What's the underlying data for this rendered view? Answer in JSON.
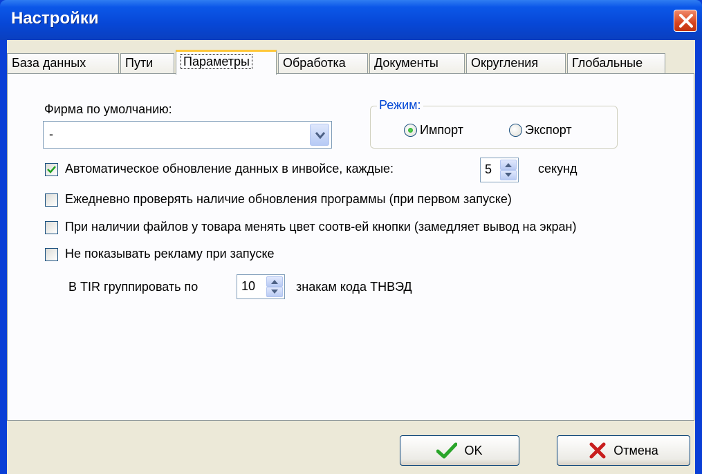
{
  "window": {
    "title": "Настройки"
  },
  "tabs": [
    {
      "label": "База данных"
    },
    {
      "label": "Пути"
    },
    {
      "label": "Параметры"
    },
    {
      "label": "Обработка"
    },
    {
      "label": "Документы"
    },
    {
      "label": "Округления"
    },
    {
      "label": "Глобальные"
    }
  ],
  "active_tab": "Параметры",
  "firm": {
    "label": "Фирма по умолчанию:",
    "value": "-"
  },
  "mode": {
    "legend": "Режим:",
    "options": [
      {
        "label": "Импорт",
        "selected": true
      },
      {
        "label": "Экспорт",
        "selected": false
      }
    ]
  },
  "options": [
    {
      "label": "Автоматическое обновление данных в инвойсе, каждые:",
      "checked": true
    },
    {
      "label": "Ежедневно проверять наличие обновления программы (при первом запуске)",
      "checked": false
    },
    {
      "label": "При наличии файлов у товара менять цвет соотв-ей кнопки (замедляет вывод на экран)",
      "checked": false
    },
    {
      "label": "Не показывать рекламу при запуске",
      "checked": false
    }
  ],
  "auto_update": {
    "value": "5",
    "unit": "секунд"
  },
  "tir": {
    "prefix": "В TIR группировать по",
    "value": "10",
    "suffix": "знакам кода ТНВЭД"
  },
  "buttons": {
    "ok": "OK",
    "cancel": "Отмена"
  },
  "colors": {
    "title_bar": "#0747d6",
    "group_legend": "#0046d5",
    "ok_icon": "#2aa52a",
    "cancel_icon": "#c81e1e",
    "dialog_bg": "#ece9d8"
  },
  "icons": {
    "close": "close-icon",
    "ok": "checkmark-icon",
    "cancel": "cross-icon"
  }
}
